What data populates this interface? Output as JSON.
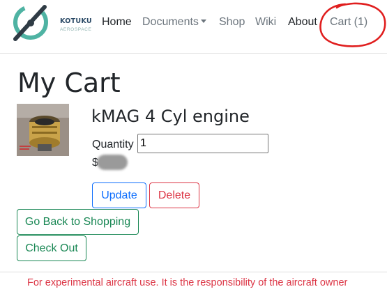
{
  "brand": {
    "name": "KOTUKU",
    "subtitle": "AEROSPACE"
  },
  "nav": {
    "home": "Home",
    "documents": "Documents",
    "shop": "Shop",
    "wiki": "Wiki",
    "about": "About",
    "cart": "Cart (1)"
  },
  "page": {
    "title": "My Cart"
  },
  "cart_item": {
    "name": "kMAG 4 Cyl engine",
    "quantity_label": "Quantity",
    "quantity_value": "1",
    "price_prefix": "$"
  },
  "buttons": {
    "update": "Update",
    "delete": "Delete",
    "back": "Go Back to Shopping",
    "checkout": "Check Out"
  },
  "footer": {
    "disclaimer": "For experimental aircraft use. It is the responsibility of the aircraft owner"
  },
  "colors": {
    "primary": "#0d6efd",
    "danger": "#dc3545",
    "success": "#198754",
    "annotation": "#e01e1e"
  },
  "icons": {
    "logo": "kotuku-propeller-logo",
    "annotation": "red-hand-drawn-circle"
  }
}
